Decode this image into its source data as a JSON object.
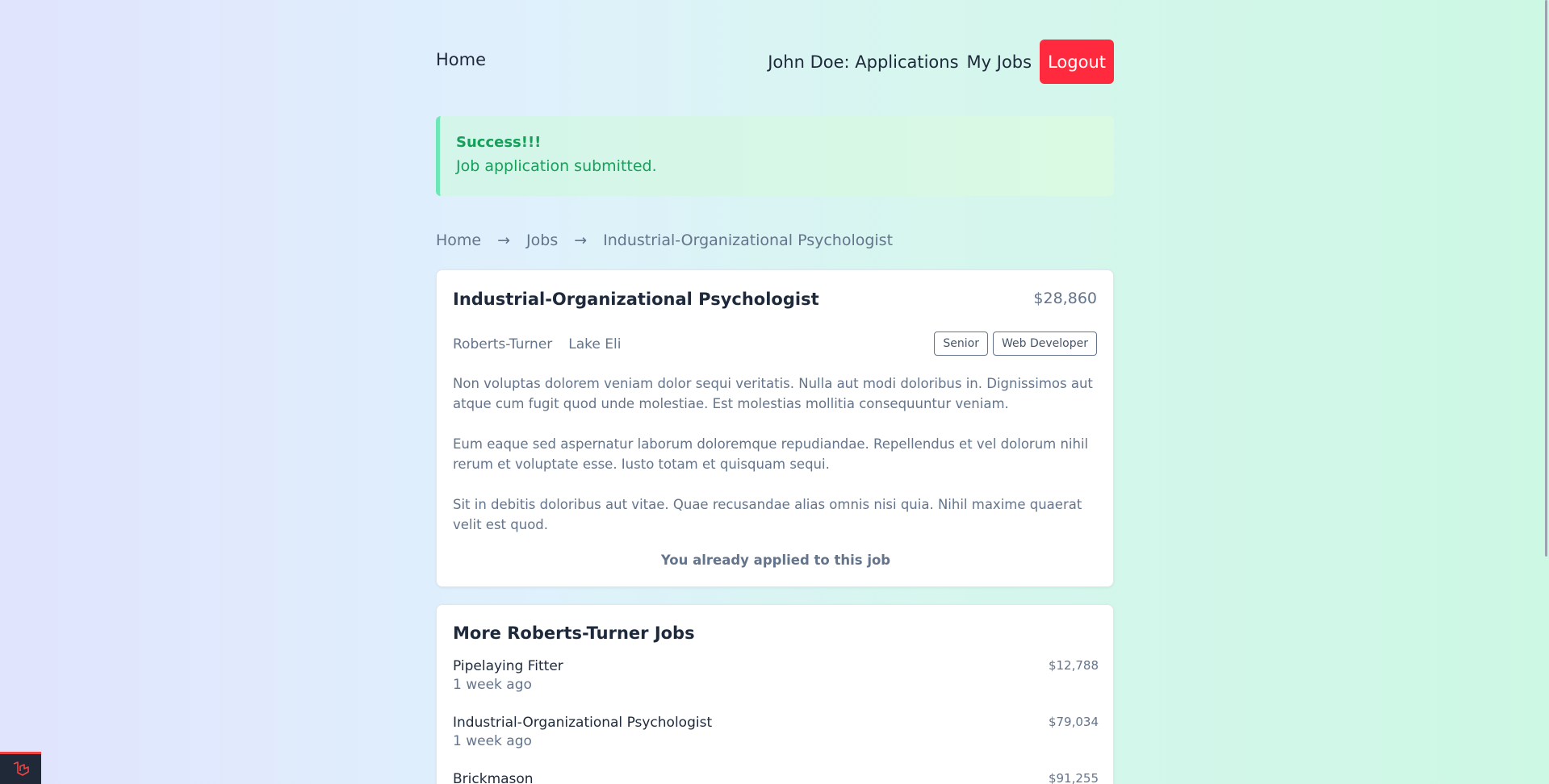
{
  "nav": {
    "home": "Home",
    "applications": "John Doe: Applications",
    "my_jobs": "My Jobs",
    "logout": "Logout"
  },
  "alert": {
    "title": "Success!!!",
    "message": "Job application submitted."
  },
  "breadcrumb": {
    "items": [
      "Home",
      "Jobs",
      "Industrial-Organizational Psychologist"
    ],
    "separator": "→"
  },
  "job": {
    "title": "Industrial-Organizational Psychologist",
    "salary": "$28,860",
    "company": "Roberts-Turner",
    "location": "Lake Eli",
    "tags": [
      "Senior",
      "Web Developer"
    ],
    "description": [
      "Non voluptas dolorem veniam dolor sequi veritatis. Nulla aut modi doloribus in. Dignissimos aut atque cum fugit quod unde molestiae. Est molestias mollitia consequuntur veniam.",
      "Eum eaque sed aspernatur laborum doloremque repudiandae. Repellendus et vel dolorum nihil rerum et voluptate esse. Iusto totam et quisquam sequi.",
      "Sit in debitis doloribus aut vitae. Quae recusandae alias omnis nisi quia. Nihil maxime quaerat velit est quod."
    ],
    "applied_text": "You already applied to this job"
  },
  "more_jobs": {
    "title": "More Roberts-Turner Jobs",
    "items": [
      {
        "name": "Pipelaying Fitter",
        "time": "1 week ago",
        "price": "$12,788"
      },
      {
        "name": "Industrial-Organizational Psychologist",
        "time": "1 week ago",
        "price": "$79,034"
      },
      {
        "name": "Brickmason",
        "time": "",
        "price": "$91,255"
      }
    ]
  },
  "colors": {
    "logout": "#ff2a3d",
    "success": "#16a05a",
    "alert_border": "#6ee7b7"
  }
}
